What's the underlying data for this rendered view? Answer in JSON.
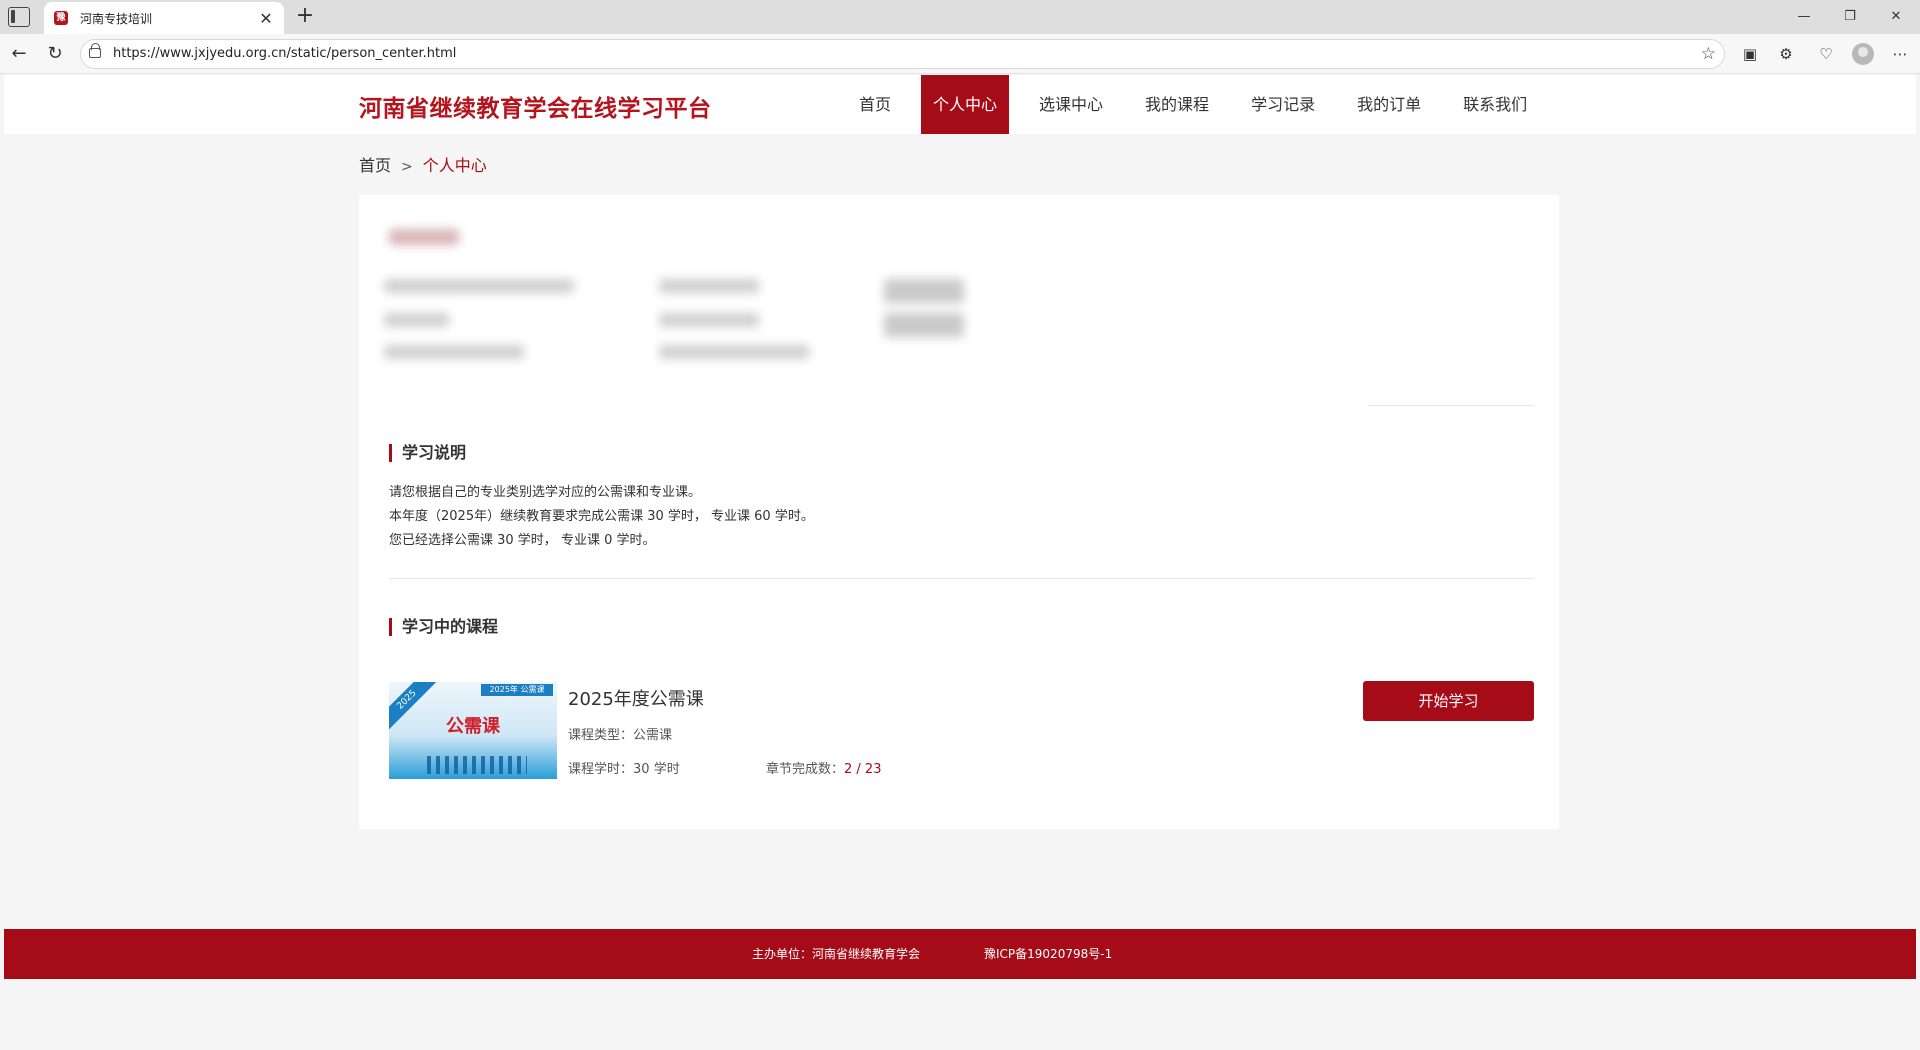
{
  "browser": {
    "tab_title": "河南专技培训",
    "url": "https://www.jxjyedu.org.cn/static/person_center.html"
  },
  "site": {
    "logo": "河南省继续教育学会在线学习平台",
    "nav": [
      "首页",
      "个人中心",
      "选课中心",
      "我的课程",
      "学习记录",
      "我的订单",
      "联系我们"
    ],
    "active_nav": "个人中心"
  },
  "breadcrumb": {
    "home": "首页",
    "separator": ">",
    "current": "个人中心"
  },
  "study_notes": {
    "title": "学习说明",
    "lines": [
      "请您根据自己的专业类别选学对应的公需课和专业课。",
      "本年度（2025年）继续教育要求完成公需课 30 学时， 专业课 60 学时。",
      "您已经选择公需课 30 学时， 专业课 0 学时。"
    ]
  },
  "courses": {
    "title": "学习中的课程",
    "items": [
      {
        "thumb_ribbon": "2025",
        "thumb_tag": "2025年 公需课",
        "thumb_text": "公需课",
        "name": "2025年度公需课",
        "type_label": "课程类型：",
        "type_value": "公需课",
        "hours_label": "课程学时：",
        "hours_value": "30 学时",
        "progress_label": "章节完成数：",
        "progress_value": "2 / 23",
        "button": "开始学习"
      }
    ]
  },
  "footer": {
    "host": "主办单位：河南省继续教育学会",
    "icp": "豫ICP备19020798号-1"
  },
  "colors": {
    "brand_red": "#a60c18"
  }
}
